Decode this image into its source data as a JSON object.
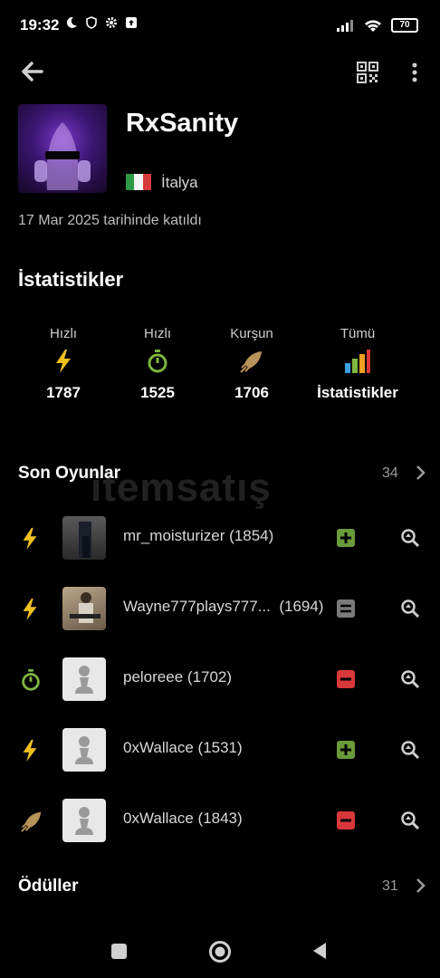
{
  "status_bar": {
    "time": "19:32",
    "battery": "70"
  },
  "profile": {
    "username": "RxSanity",
    "country": "İtalya",
    "joined": "17 Mar 2025 tarihinde katıldı"
  },
  "stats": {
    "title": "İstatistikler",
    "items": [
      {
        "label": "Hızlı",
        "value": "1787",
        "icon": "bolt-icon",
        "color": "#f0c020"
      },
      {
        "label": "Hızlı",
        "value": "1525",
        "icon": "stopwatch-icon",
        "color": "#7fb63f"
      },
      {
        "label": "Kurşun",
        "value": "1706",
        "icon": "bullet-icon",
        "color": "#b8935a"
      },
      {
        "label": "Tümü",
        "value": "İstatistikler",
        "icon": "bar-chart-icon"
      }
    ]
  },
  "recent_games": {
    "title": "Son Oyunlar",
    "count": "34",
    "rows": [
      {
        "mode": "bolt-icon",
        "name": "mr_moisturizer",
        "rating": "(1854)",
        "result": "win"
      },
      {
        "mode": "bolt-icon",
        "name": "Wayne777plays777...",
        "rating": "(1694)",
        "result": "draw"
      },
      {
        "mode": "stopwatch-icon",
        "name": "peloreee",
        "rating": "(1702)",
        "result": "loss"
      },
      {
        "mode": "bolt-icon",
        "name": "0xWallace",
        "rating": "(1531)",
        "result": "win"
      },
      {
        "mode": "bullet-icon",
        "name": "0xWallace",
        "rating": "(1843)",
        "result": "loss"
      }
    ]
  },
  "awards": {
    "title": "Ödüller",
    "count": "31"
  },
  "watermark": "itemsatış",
  "colors": {
    "win": "#6a9a3a",
    "loss": "#d9383a",
    "draw": "#7a7a7a",
    "bolt": "#f0c020",
    "rapid": "#7fb63f",
    "bullet": "#b8935a"
  }
}
